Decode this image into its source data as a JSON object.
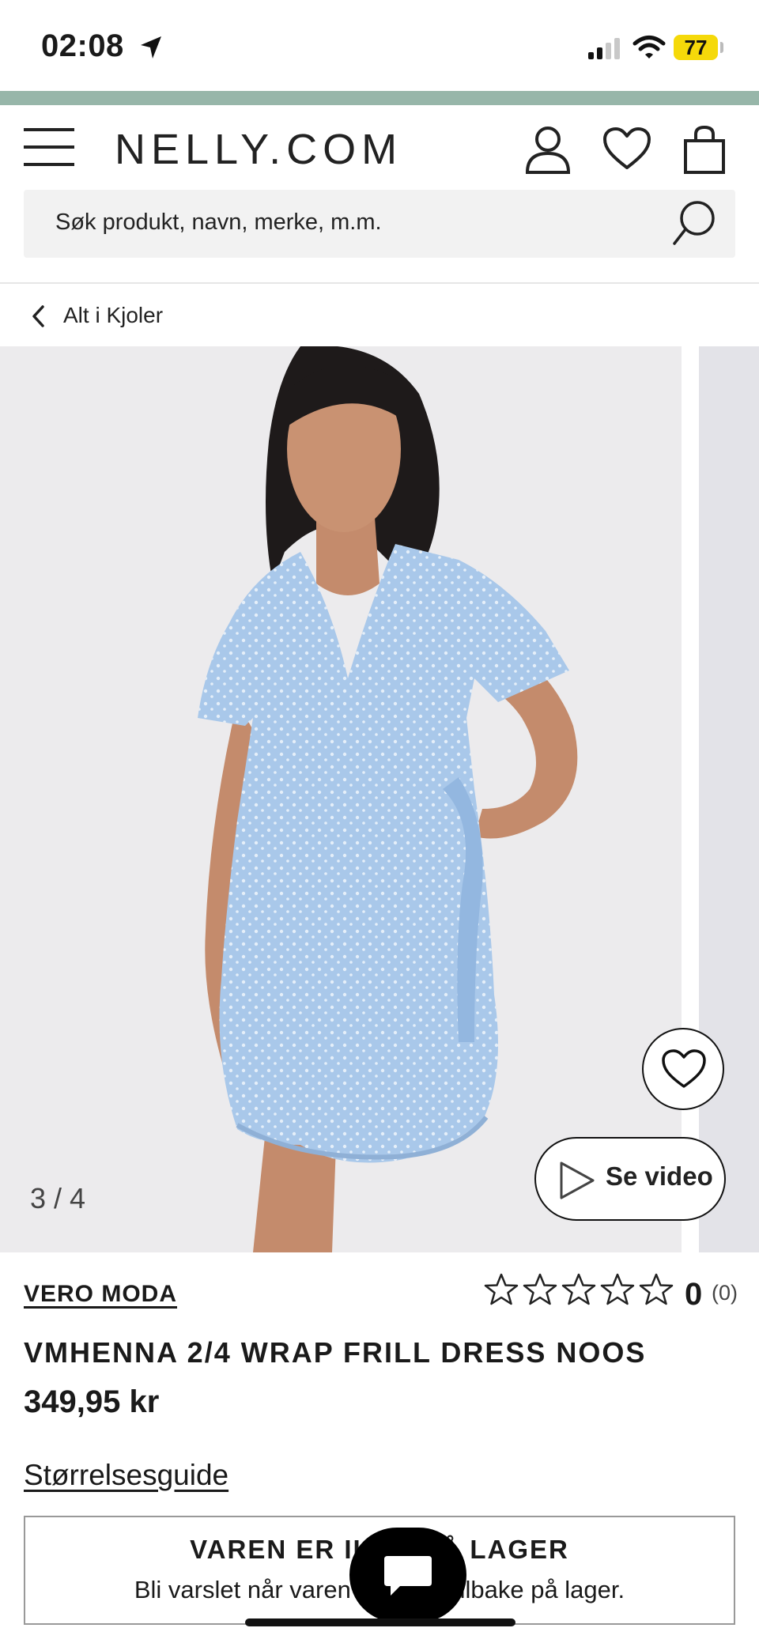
{
  "status_bar": {
    "time": "02:08",
    "battery": "77"
  },
  "header": {
    "logo": "NELLY.COM"
  },
  "search": {
    "placeholder": "Søk produkt, navn, merke, m.m."
  },
  "breadcrumb": {
    "back_label": "Alt i Kjoler"
  },
  "gallery": {
    "counter": "3 / 4",
    "video_label": "Se video"
  },
  "product": {
    "brand": "VERO MODA",
    "rating_value": "0",
    "rating_count": "(0)",
    "rating_stars": 0,
    "title": "VMHENNA 2/4 WRAP FRILL DRESS NOOS",
    "price": "349,95 kr",
    "size_guide": "Størrelsesguide"
  },
  "stock": {
    "title": "VAREN ER IKKE PÅ LAGER",
    "subtitle": "Bli varslet når varen kommer tilbake på lager."
  },
  "colors": {
    "promo_strip": "#97b6a9",
    "dress": "#a9c8ea",
    "battery": "#f5d90a"
  }
}
